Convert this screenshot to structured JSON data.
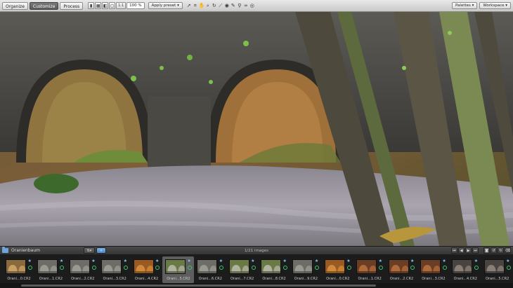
{
  "toolbar": {
    "tabs": [
      {
        "label": "Organize",
        "active": false
      },
      {
        "label": "Customize",
        "active": true
      },
      {
        "label": "Process",
        "active": false
      }
    ],
    "ratio": "1:1",
    "zoom": "100 %",
    "preset": "Apply preset",
    "palettes": "Palettes",
    "workspace": "Workspace"
  },
  "browser": {
    "folder": "Oranienbaum",
    "count_text": "1/21 images"
  },
  "filmstrip": {
    "items": [
      {
        "label": "Orani...0.CR2",
        "tone": "warm",
        "selected": false
      },
      {
        "label": "Orani...1.CR2",
        "tone": "gray",
        "selected": false
      },
      {
        "label": "Orani...2.CR2",
        "tone": "gray",
        "selected": false
      },
      {
        "label": "Orani...3.CR2",
        "tone": "gray",
        "selected": false
      },
      {
        "label": "Orani...4.CR2",
        "tone": "orange",
        "selected": false
      },
      {
        "label": "Orani...5.CR2",
        "tone": "green",
        "selected": true
      },
      {
        "label": "Orani...6.CR2",
        "tone": "gray",
        "selected": false
      },
      {
        "label": "Orani...7.CR2",
        "tone": "green",
        "selected": false
      },
      {
        "label": "Orani...8.CR2",
        "tone": "green",
        "selected": false
      },
      {
        "label": "Orani...9.CR2",
        "tone": "gray",
        "selected": false
      },
      {
        "label": "Orani...0.CR2",
        "tone": "orange",
        "selected": false
      },
      {
        "label": "Orani...1.CR2",
        "tone": "brown",
        "selected": false
      },
      {
        "label": "Orani...2.CR2",
        "tone": "brown",
        "selected": false
      },
      {
        "label": "Orani...3.CR2",
        "tone": "brown",
        "selected": false
      },
      {
        "label": "Orani...4.CR2",
        "tone": "dark",
        "selected": false
      },
      {
        "label": "Orani...5.CR2",
        "tone": "dark",
        "selected": false
      }
    ]
  },
  "colors": {
    "selection": "#5e5e5e",
    "star_badge": "#7ec4f0",
    "green_badge": "#3ec46d",
    "folder": "#6ea4dc"
  }
}
